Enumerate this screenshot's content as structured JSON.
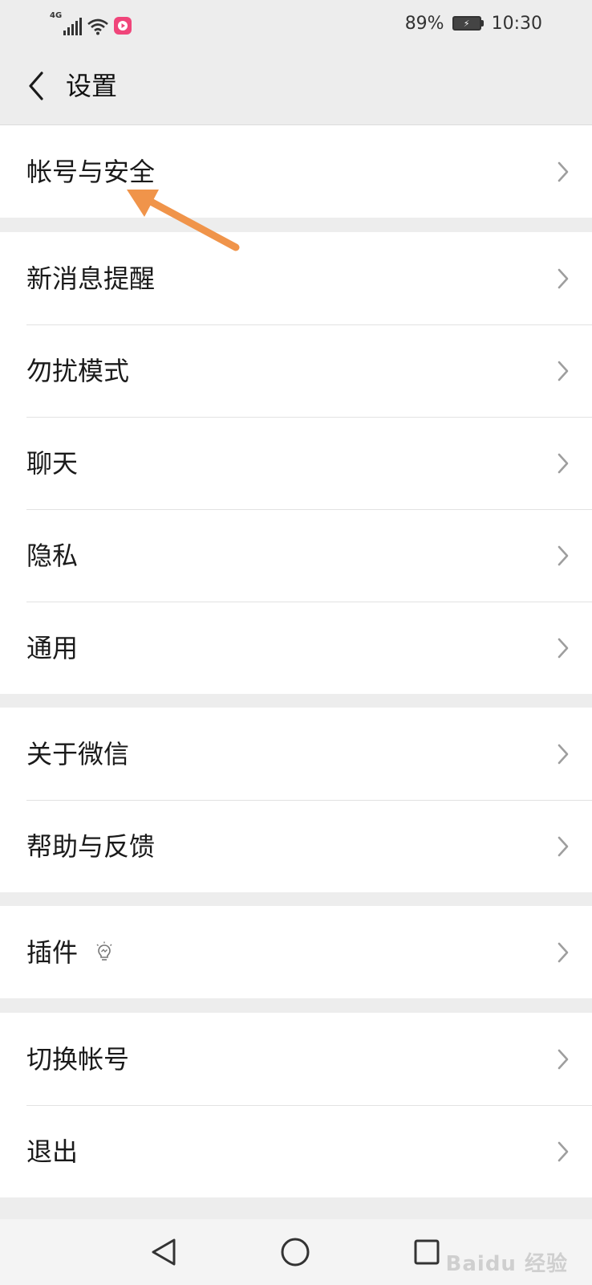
{
  "status_bar": {
    "network": "4G",
    "battery_percent": "89%",
    "time": "10:30",
    "icons": [
      "signal-icon",
      "wifi-icon",
      "video-app-icon",
      "battery-charging-icon"
    ]
  },
  "header": {
    "title": "设置",
    "back_icon": "chevron-left-icon"
  },
  "groups": [
    {
      "items": [
        {
          "label": "帐号与安全"
        }
      ]
    },
    {
      "items": [
        {
          "label": "新消息提醒"
        },
        {
          "label": "勿扰模式"
        },
        {
          "label": "聊天"
        },
        {
          "label": "隐私"
        },
        {
          "label": "通用"
        }
      ]
    },
    {
      "items": [
        {
          "label": "关于微信"
        },
        {
          "label": "帮助与反馈"
        }
      ]
    },
    {
      "items": [
        {
          "label": "插件",
          "icon": "lightbulb-icon"
        }
      ]
    },
    {
      "items": [
        {
          "label": "切换帐号"
        },
        {
          "label": "退出"
        }
      ]
    }
  ],
  "navigation_bar": {
    "buttons": [
      "back-triangle-icon",
      "home-circle-icon",
      "recents-square-icon"
    ]
  },
  "annotation": {
    "color": "#f0944a"
  },
  "watermark": "Baidu 经验",
  "colors": {
    "background": "#ededed",
    "card": "#ffffff",
    "divider": "#e2e2e2",
    "chevron": "#9e9e9e",
    "badge": "#f0457a"
  }
}
